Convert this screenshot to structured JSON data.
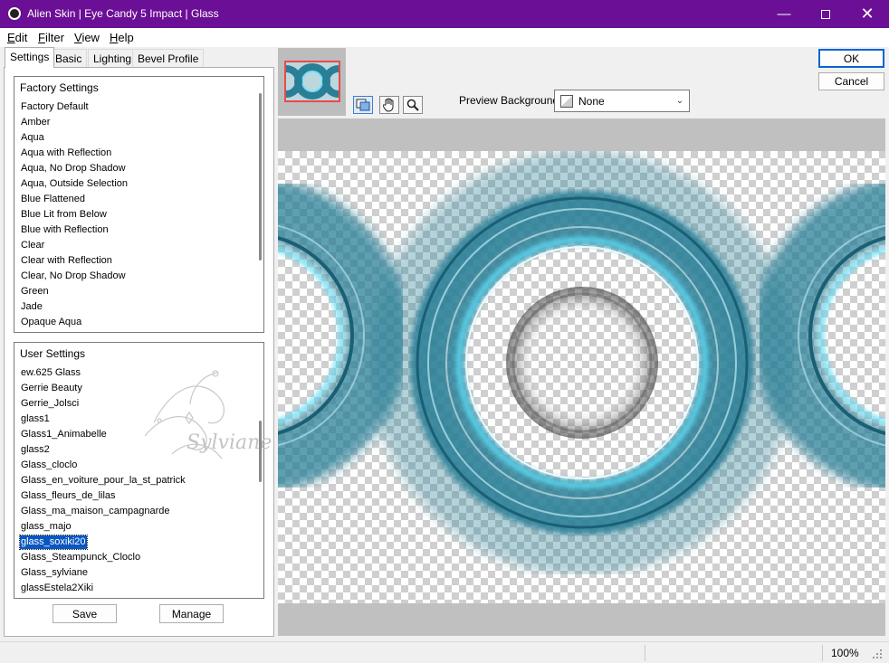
{
  "window": {
    "title": "Alien Skin | Eye Candy 5 Impact | Glass",
    "controls": [
      "minimize-icon",
      "maximize-icon",
      "close-icon"
    ]
  },
  "menu": [
    {
      "label": "Edit",
      "mnemonic": "E",
      "rest": "dit"
    },
    {
      "label": "Filter",
      "mnemonic": "F",
      "rest": "ilter"
    },
    {
      "label": "View",
      "mnemonic": "V",
      "rest": "iew"
    },
    {
      "label": "Help",
      "mnemonic": "H",
      "rest": "elp"
    }
  ],
  "tabs": [
    {
      "label": "Settings",
      "active": true
    },
    {
      "label": "Basic",
      "active": false
    },
    {
      "label": "Lighting",
      "active": false
    },
    {
      "label": "Bevel Profile",
      "active": false
    }
  ],
  "factory_settings": {
    "header": "Factory Settings",
    "items": [
      "Factory Default",
      "Amber",
      "Aqua",
      "Aqua with Reflection",
      "Aqua, No Drop Shadow",
      "Aqua, Outside Selection",
      "Blue Flattened",
      "Blue Lit from Below",
      "Blue with Reflection",
      "Clear",
      "Clear with Reflection",
      "Clear, No Drop Shadow",
      "Green",
      "Jade",
      "Opaque Aqua"
    ]
  },
  "user_settings": {
    "header": "User Settings",
    "items": [
      "ew.625 Glass",
      "Gerrie Beauty",
      "Gerrie_Jolsci",
      "glass1",
      "Glass1_Animabelle",
      "glass2",
      "Glass_cloclo",
      "Glass_en_voiture_pour_la_st_patrick",
      "Glass_fleurs_de_lilas",
      "Glass_ma_maison_campagnarde",
      "glass_majo",
      "glass_soxiki20",
      "Glass_Steampunck_Cloclo",
      "Glass_sylviane",
      "glassEstela2Xiki"
    ],
    "selected": "glass_soxiki20",
    "watermark": "Sylviane"
  },
  "buttons": {
    "save": "Save",
    "manage": "Manage",
    "ok": "OK",
    "cancel": "Cancel"
  },
  "preview": {
    "background_label": "Preview Background:",
    "background_value": "None",
    "tools": [
      "preview-toggle-icon",
      "hand-icon",
      "zoom-icon"
    ]
  },
  "status": {
    "zoom": "100%"
  },
  "colors": {
    "titlebar": "#6b0f96",
    "selection": "#0a57c2",
    "glass_teal": "#2a7f96",
    "glass_highlight": "#5fe4ff"
  }
}
